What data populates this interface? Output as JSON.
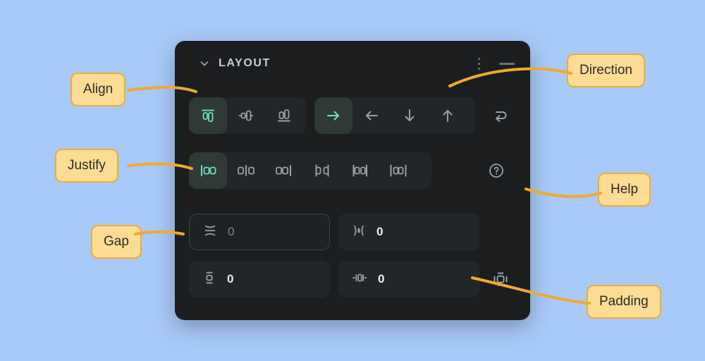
{
  "canvas": {
    "background": "#a8caf8"
  },
  "panel": {
    "background": "#1b1d1f",
    "accent": "#6fe0b8",
    "header": {
      "title": "LAYOUT",
      "collapse_icon": "chevron-down-icon",
      "menu_icon": "kebab-menu-icon",
      "minimize_icon": "minimize-dash-icon"
    },
    "align": {
      "label": "Align",
      "selected_index": 0,
      "options": [
        {
          "name": "align-start-icon",
          "value": "start"
        },
        {
          "name": "align-center-icon",
          "value": "center"
        },
        {
          "name": "align-end-icon",
          "value": "end"
        }
      ]
    },
    "direction": {
      "label": "Direction",
      "selected_index": 0,
      "options": [
        {
          "name": "arrow-right-icon",
          "value": "row"
        },
        {
          "name": "arrow-left-icon",
          "value": "row-reverse"
        },
        {
          "name": "arrow-down-icon",
          "value": "column"
        },
        {
          "name": "arrow-up-icon",
          "value": "column-reverse"
        }
      ],
      "wrap_icon": "wrap-icon"
    },
    "justify": {
      "label": "Justify",
      "selected_index": 0,
      "options": [
        {
          "name": "justify-start-icon",
          "value": "flex-start"
        },
        {
          "name": "justify-center-icon",
          "value": "center"
        },
        {
          "name": "justify-end-icon",
          "value": "flex-end"
        },
        {
          "name": "justify-space-between-icon",
          "value": "space-between"
        },
        {
          "name": "justify-space-around-icon",
          "value": "space-around"
        },
        {
          "name": "justify-space-evenly-icon",
          "value": "space-evenly"
        }
      ],
      "help_icon": "help-circle-icon"
    },
    "gap": {
      "label": "Gap",
      "vertical": {
        "icon": "gap-vertical-icon",
        "value": "0",
        "focused": true
      },
      "horizontal": {
        "icon": "gap-horizontal-icon",
        "value": "0",
        "focused": false
      }
    },
    "padding": {
      "label": "Padding",
      "vertical": {
        "icon": "padding-vertical-icon",
        "value": "0"
      },
      "horizontal": {
        "icon": "padding-horizontal-icon",
        "value": "0"
      },
      "all_icon": "padding-all-icon"
    }
  },
  "callouts": [
    {
      "id": "align",
      "label": "Align"
    },
    {
      "id": "justify",
      "label": "Justify"
    },
    {
      "id": "gap",
      "label": "Gap"
    },
    {
      "id": "direction",
      "label": "Direction"
    },
    {
      "id": "help",
      "label": "Help"
    },
    {
      "id": "padding",
      "label": "Padding"
    }
  ]
}
